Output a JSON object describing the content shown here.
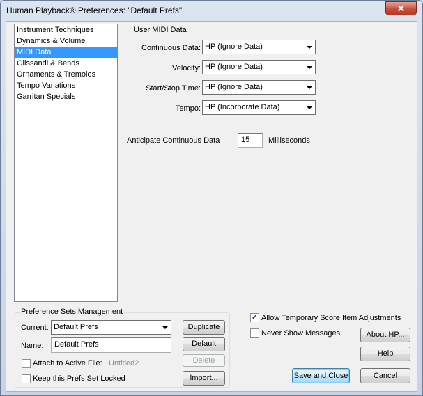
{
  "window": {
    "title": "Human Playback® Preferences: \"Default Prefs\"",
    "close_glyph": "✕"
  },
  "category_list": {
    "items": [
      "Instrument Techniques",
      "Dynamics & Volume",
      "MIDI Data",
      "Glissandi & Bends",
      "Ornaments & Tremolos",
      "Tempo Variations",
      "Garritan Specials"
    ],
    "selected": "MIDI Data"
  },
  "midi_group": {
    "legend": "User MIDI Data",
    "continuous_label": "Continuous Data:",
    "continuous_value": "HP (Ignore Data)",
    "velocity_label": "Velocity:",
    "velocity_value": "HP (Ignore Data)",
    "startstop_label": "Start/Stop Time:",
    "startstop_value": "HP (Ignore Data)",
    "tempo_label": "Tempo:",
    "tempo_value": "HP (Incorporate Data)"
  },
  "anticipate": {
    "label": "Anticipate Continuous Data",
    "value": "15",
    "unit": "Milliseconds"
  },
  "pref_sets": {
    "legend": "Preference Sets Management",
    "current_label": "Current:",
    "current_value": "Default Prefs",
    "name_label": "Name:",
    "name_value": "Default Prefs",
    "attach_label": "Attach to Active File:",
    "attach_file": "Untitled2",
    "attach_checked": false,
    "lock_label": "Keep this Prefs Set Locked",
    "lock_checked": false,
    "duplicate": "Duplicate",
    "default": "Default",
    "delete": "Delete",
    "import": "Import..."
  },
  "options": {
    "allow_temp_label": "Allow Temporary Score Item Adjustments",
    "allow_temp_checked": true,
    "never_show_label": "Never Show Messages",
    "never_show_checked": false
  },
  "buttons": {
    "about": "About HP...",
    "help": "Help",
    "save_close": "Save and Close",
    "cancel": "Cancel"
  }
}
